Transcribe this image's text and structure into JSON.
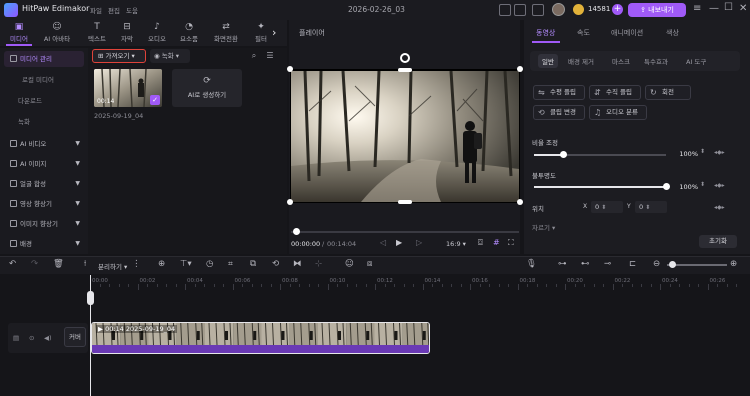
{
  "app": {
    "name": "HitPaw Edimakor",
    "menus": [
      "파일",
      "편집",
      "도움"
    ],
    "document_title": "2026-02-26_03",
    "credits": "14581",
    "export_label": "내보내기"
  },
  "colors": {
    "accent": "#a05af7",
    "highlight_red": "#e0433a",
    "clip_bar": "#6a39b5"
  },
  "toolbar": {
    "tools": [
      {
        "label": "미디어",
        "icon": "media-icon"
      },
      {
        "label": "AI 아바타",
        "icon": "avatar-icon"
      },
      {
        "label": "텍스트",
        "icon": "text-icon"
      },
      {
        "label": "자막",
        "icon": "subtitle-icon"
      },
      {
        "label": "오디오",
        "icon": "audio-icon"
      },
      {
        "label": "요소품",
        "icon": "sticker-icon"
      },
      {
        "label": "화면전환",
        "icon": "transition-icon"
      },
      {
        "label": "필터",
        "icon": "filter-icon"
      }
    ]
  },
  "sidebar": {
    "items": [
      {
        "label": "미디어 관리"
      },
      {
        "label": "로컬 미디어"
      },
      {
        "label": "다운로드"
      },
      {
        "label": "녹화"
      },
      {
        "label": "AI 비디오"
      },
      {
        "label": "AI 이미지"
      },
      {
        "label": "얼굴 합성"
      },
      {
        "label": "영상 향상기"
      },
      {
        "label": "이미지 향상기"
      },
      {
        "label": "배경"
      }
    ]
  },
  "media": {
    "import_label": "가져오기",
    "record_label": "녹화",
    "item": {
      "duration": "00:14",
      "name": "2025-09-19_04"
    },
    "ai_generate_label": "AI로 생성하기"
  },
  "player": {
    "title": "플레이어",
    "current_time": "00:00:00",
    "total_time": "00:14:04",
    "aspect": "16:9"
  },
  "properties": {
    "tabs": [
      "동영상",
      "속도",
      "애니메이션",
      "색상"
    ],
    "subtabs": [
      "일반",
      "배경 제거",
      "마스크",
      "특수효과",
      "AI 도구"
    ],
    "buttons": [
      "수평 플립",
      "수직 플립",
      "회전",
      "클립 변경",
      "오디오 분류"
    ],
    "scale": {
      "label": "비율 조정",
      "value": "100%",
      "level": 0.22
    },
    "opacity": {
      "label": "불투명도",
      "value": "100%",
      "level": 1.0
    },
    "position": {
      "label": "위치",
      "x_label": "X",
      "x": "0",
      "y_label": "Y",
      "y": "0"
    },
    "more_label": "자르기 ▾",
    "reset_label": "초기화"
  },
  "timeline": {
    "split_label": "분리하기",
    "ruler": [
      "00:00",
      "00:02",
      "00:04",
      "00:06",
      "00:08",
      "00:10",
      "00:12",
      "00:14",
      "00:16",
      "00:18",
      "00:20",
      "00:22",
      "00:24",
      "00:26"
    ],
    "cover_label": "커버",
    "clip_label": "00:14 2025-09-19_04"
  }
}
